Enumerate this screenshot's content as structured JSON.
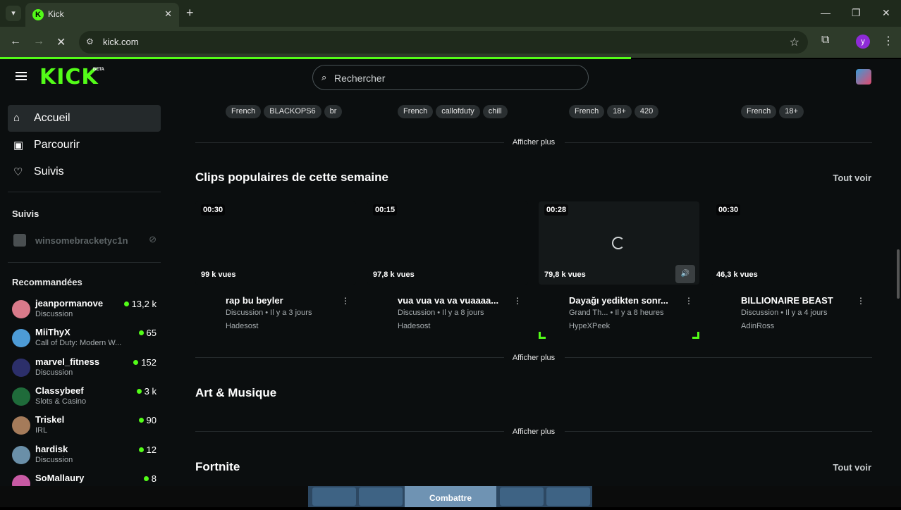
{
  "browser": {
    "tab_title": "Kick",
    "url": "kick.com",
    "profile_initial": "y",
    "load_progress": 0.7
  },
  "header": {
    "logo": "KICK",
    "logo_badge": "BETA",
    "search_placeholder": "Rechercher"
  },
  "sidebar": {
    "nav": [
      {
        "label": "Accueil",
        "icon": "home-icon"
      },
      {
        "label": "Parcourir",
        "icon": "browse-icon"
      },
      {
        "label": "Suivis",
        "icon": "heart-icon"
      }
    ],
    "followed_title": "Suivis",
    "followed": [
      {
        "name": "winsomebracketyc1n",
        "status": "offline"
      }
    ],
    "recommended_title": "Recommandées",
    "recommended": [
      {
        "name": "jeanpormanove",
        "category": "Discussion",
        "viewers": "13,2 k",
        "color": "#d97a8a"
      },
      {
        "name": "MiiThyX",
        "category": "Call of Duty: Modern W...",
        "viewers": "65",
        "color": "#4d9bd6"
      },
      {
        "name": "marvel_fitness",
        "category": "Discussion",
        "viewers": "152",
        "color": "#2c2f6a"
      },
      {
        "name": "Classybeef",
        "category": "Slots & Casino",
        "viewers": "3 k",
        "color": "#1f6b3a"
      },
      {
        "name": "Triskel",
        "category": "IRL",
        "viewers": "90",
        "color": "#a57b5a"
      },
      {
        "name": "hardisk",
        "category": "Discussion",
        "viewers": "12",
        "color": "#6a8fa8"
      },
      {
        "name": "SoMallaury",
        "category": "",
        "viewers": "8",
        "color": "#c85aa4"
      }
    ]
  },
  "top_tags": [
    [
      "French",
      "BLACKOPS6",
      "br"
    ],
    [
      "French",
      "callofduty",
      "chill"
    ],
    [
      "French",
      "18+",
      "420"
    ],
    [
      "French",
      "18+"
    ]
  ],
  "show_more": "Afficher plus",
  "clips_section": {
    "title": "Clips populaires de cette semaine",
    "see_all": "Tout voir",
    "clips": [
      {
        "duration": "00:30",
        "views": "99 k vues",
        "title": "rap bu beyler",
        "meta": "Discussion • Il y a 3 jours",
        "author": "Hadesost"
      },
      {
        "duration": "00:15",
        "views": "97,8 k vues",
        "title": "vua vua va va vuaaaa...",
        "meta": "Discussion • Il y a 8 jours",
        "author": "Hadesost"
      },
      {
        "duration": "00:28",
        "views": "79,8 k vues",
        "title": "Dayağı yedikten sonr...",
        "meta": "Grand Th... • Il y a 8 heures",
        "author": "HypeXPeek"
      },
      {
        "duration": "00:30",
        "views": "46,3 k vues",
        "title": "BILLIONAIRE BEAST",
        "meta": "Discussion • Il y a 4 jours",
        "author": "AdinRoss"
      }
    ]
  },
  "art_section": {
    "title": "Art & Musique"
  },
  "fortnite_section": {
    "title": "Fortnite",
    "see_all": "Tout voir"
  },
  "game_banner": {
    "label": "Combattre"
  },
  "colors": {
    "brand": "#53fc18",
    "background": "#0b0e0f"
  }
}
